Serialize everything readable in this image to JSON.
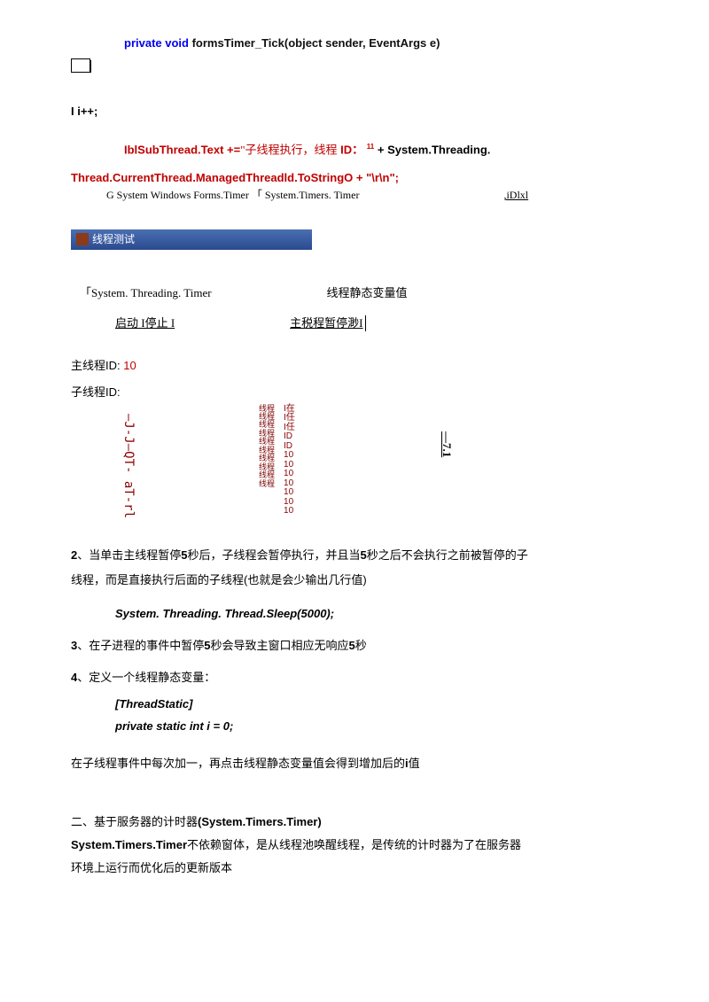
{
  "code": {
    "decl_kw": "private void ",
    "decl_method": "formsTimer_Tick(object sender, EventArgs e)",
    "ii": "I i++;",
    "lbl_prefix": "IblSubThread.Text +=",
    "lbl_str1": "\"子线程执行，线程",
    "lbl_id": " ID：",
    "lbl_sup": "11",
    "lbl_plus": " + System.Threading.",
    "line3": "Thread.CurrentThread.ManagedThreadld.ToStringO + \"\\r\\n\";",
    "note": "G System Windows Forms.Timer 「 System.Timers. Timer",
    "idlxl": ",iDlxl"
  },
  "ui": {
    "titlebar": "线程测试",
    "timer_label": "「System. Threading. Timer",
    "static_var": "线程静态变量值",
    "btn_start_stop": "启动 I停止 I",
    "btn_pause": "主税程暂停渺I",
    "main_thread": "主线程ID: ",
    "main_thread_id": "10",
    "sub_thread": "子线程ID:",
    "vert1": "—J-J—QT-  aT-rl",
    "col_text": "线程\n线程\n线程\n线程\n线程\n线程\n线程\n线程\n线程\n线程",
    "col_id": "I在\nI任\nI任\nID\nID\n10\n10\n10\n10\n10\n10\n10",
    "vert7": "—7.1"
  },
  "body": {
    "p2_n": "2",
    "p2_a": "、当单击主线程暂停",
    "p2_b": "5",
    "p2_c": "秒后，子线程会暂停执行，并且当",
    "p2_d": "5",
    "p2_e": "秒之后不会执行之前被暂停的子",
    "p2_f": "线程，而是直接执行后面的子线程(也就是会少输出几行值)",
    "code_sleep": "System. Threading. Thread.Sleep(5000);",
    "p3_n": "3",
    "p3_a": "、在子进程的事件中暂停",
    "p3_b": "5",
    "p3_c": "秒会导致主窗口相应无响应",
    "p3_d": "5",
    "p3_e": "秒",
    "p4_n": "4",
    "p4_a": "、定义一个线程静态变量：",
    "code_ts1": "[ThreadStatic]",
    "code_ts2": "private static int i = 0;",
    "p5": "在子线程事件中每次加一，再点击线程静态变量值会得到增加后的",
    "p5_b": "i",
    "p5_c": "值",
    "sec_a": "二、基于服务器的计时器",
    "sec_b": "(System.Timers.Timer)",
    "sec2_a": "System.Timers.Timer",
    "sec2_b": "不依赖窗体，是从线程池唤醒线程，是传统的计时器为了在服务器",
    "sec2_c": "环境上运行而优化后的更新版本"
  }
}
